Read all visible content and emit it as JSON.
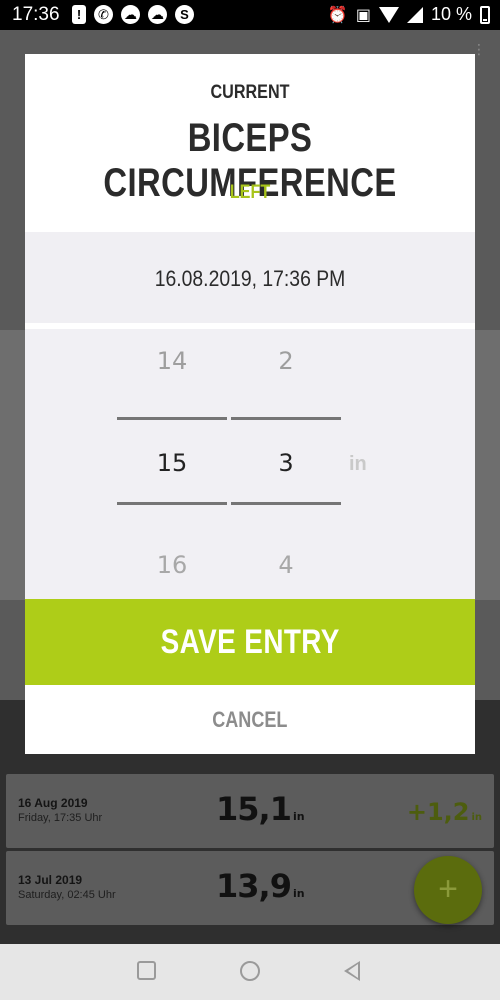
{
  "status_bar": {
    "time": "17:36",
    "notification_icons": [
      "alert-icon",
      "whatsapp-icon",
      "cloud-icon",
      "cloud-icon",
      "skype-icon"
    ],
    "battery_text": "10 %",
    "system_icons": [
      "alarm-icon",
      "nfc-icon",
      "wifi-icon",
      "signal-icon",
      "battery-icon"
    ]
  },
  "dialog": {
    "kicker": "CURRENT",
    "title": "BICEPS CIRCUMFERENCE",
    "side": "LEFT",
    "datetime": "16.08.2019, 17:36 PM",
    "picker": {
      "integer": {
        "prev": "14",
        "selected": "15",
        "next": "16"
      },
      "fraction": {
        "prev": "2",
        "selected": "3",
        "next": "4"
      },
      "unit": "in"
    },
    "save_label": "SAVE ENTRY",
    "cancel_label": "CANCEL"
  },
  "entries": [
    {
      "date": "16 Aug 2019",
      "day": "Friday, 17:35 Uhr",
      "value": "15,1",
      "unit": "in",
      "delta": "+1,2",
      "delta_unit": "in"
    },
    {
      "date": "13 Jul 2019",
      "day": "Saturday, 02:45 Uhr",
      "value": "13,9",
      "unit": "in"
    }
  ],
  "fab_label": "+",
  "colors": {
    "accent": "#aecd18",
    "side_text": "#a8c41b",
    "dialog_bg": "#ffffff",
    "picker_bg": "#f1f0f4"
  }
}
